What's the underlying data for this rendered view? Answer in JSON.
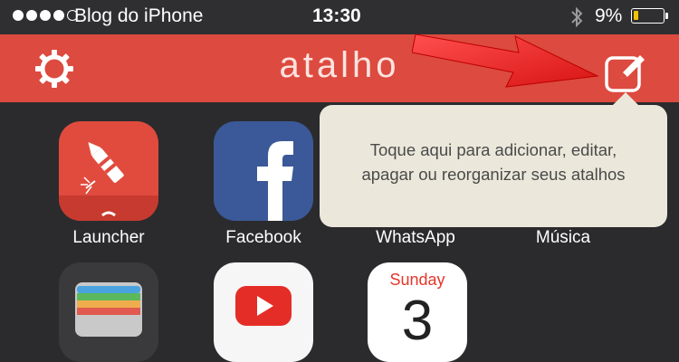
{
  "status_bar": {
    "carrier": "Blog do iPhone",
    "time": "13:30",
    "battery": "9%",
    "battery_level": 0.09
  },
  "navbar": {
    "title": "atalho",
    "color": "#dd4a3f",
    "settings_icon": "gear-icon",
    "edit_icon": "compose-icon"
  },
  "apps": [
    {
      "label": "Launcher",
      "icon": "rocket-icon"
    },
    {
      "label": "Facebook",
      "icon": "facebook-icon"
    },
    {
      "label": "WhatsApp",
      "icon": "whatsapp-icon"
    },
    {
      "label": "Música",
      "icon": "music-icon"
    }
  ],
  "apps_row2": [
    {
      "icon": "passbook-icon"
    },
    {
      "icon": "youtube-icon"
    },
    {
      "icon": "calendar-icon",
      "day": "Sunday",
      "date": "3"
    }
  ],
  "tooltip": {
    "text": "Toque aqui para adicionar, editar,\napagar ou reorganizar seus atalhos"
  },
  "accent": {
    "arrow": "#e5262a",
    "tooltip_bg": "#ebe8db"
  }
}
